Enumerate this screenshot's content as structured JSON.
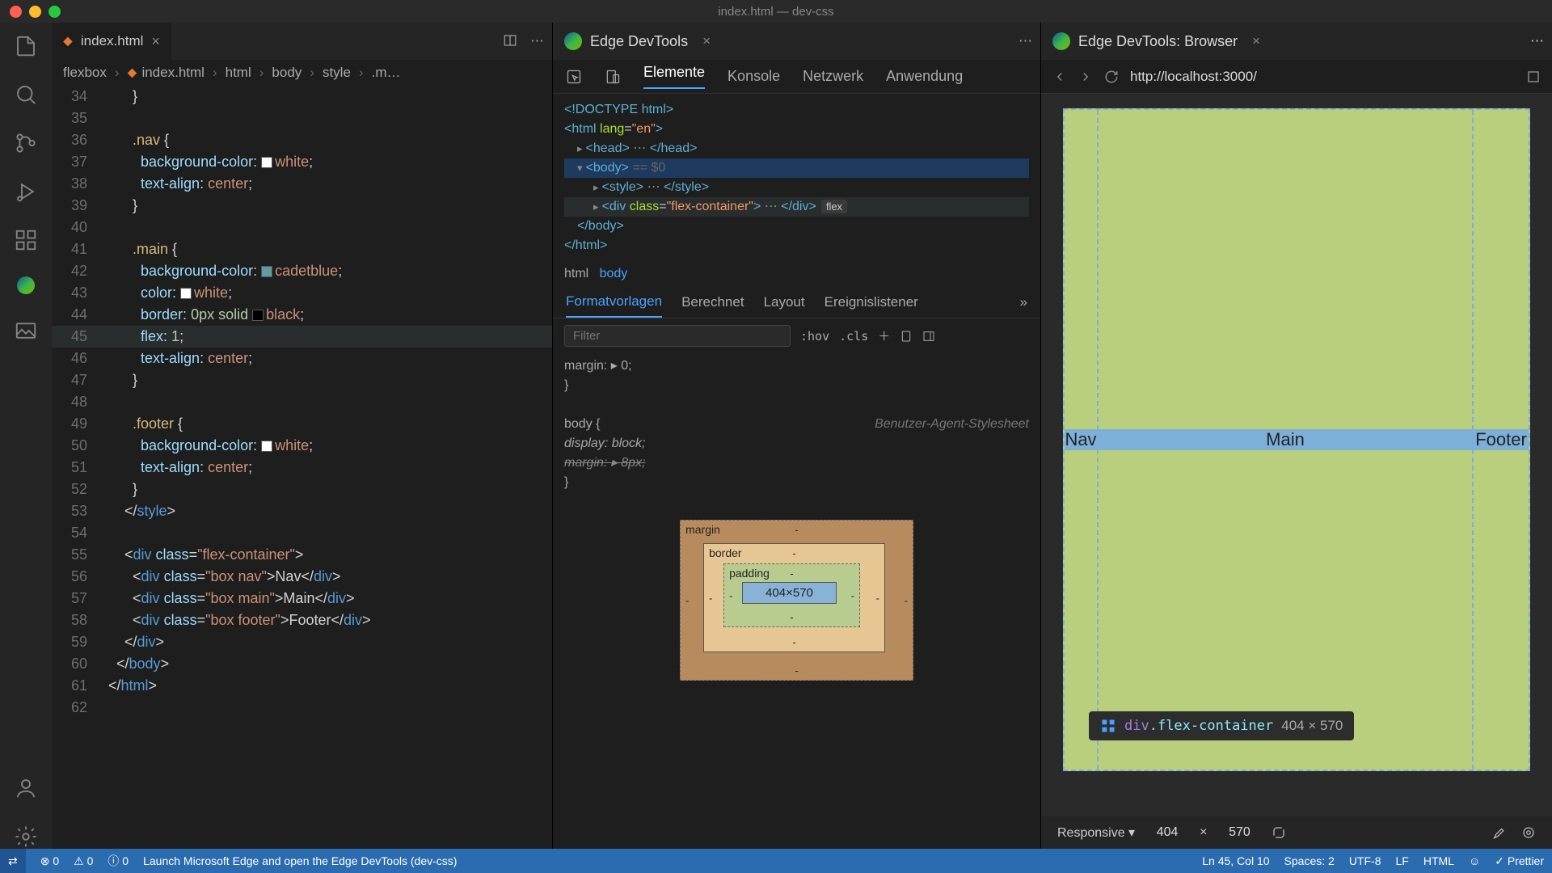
{
  "window": {
    "title": "index.html — dev-css"
  },
  "editor": {
    "tab_label": "index.html",
    "breadcrumb": [
      "flexbox",
      "index.html",
      "html",
      "body",
      "style",
      ".m…"
    ],
    "lines": [
      {
        "n": 34,
        "indent": 3,
        "t": "}"
      },
      {
        "n": 35,
        "indent": 0,
        "t": ""
      },
      {
        "n": 36,
        "indent": 3,
        "sel": ".nav",
        "t": " {"
      },
      {
        "n": 37,
        "indent": 4,
        "prop": "background-color",
        "swatch": "#ffffff",
        "val": "white"
      },
      {
        "n": 38,
        "indent": 4,
        "prop": "text-align",
        "val": "center"
      },
      {
        "n": 39,
        "indent": 3,
        "t": "}"
      },
      {
        "n": 40,
        "indent": 0,
        "t": ""
      },
      {
        "n": 41,
        "indent": 3,
        "sel": ".main",
        "t": " {"
      },
      {
        "n": 42,
        "indent": 4,
        "prop": "background-color",
        "swatch": "#5f9ea0",
        "val": "cadetblue"
      },
      {
        "n": 43,
        "indent": 4,
        "prop": "color",
        "swatch": "#ffffff",
        "val": "white"
      },
      {
        "n": 44,
        "indent": 4,
        "prop": "border",
        "val": "0px solid ",
        "swatch2": "#000000",
        "val2": "black"
      },
      {
        "n": 45,
        "indent": 4,
        "prop": "f|lex",
        "val": "1",
        "hl": true
      },
      {
        "n": 46,
        "indent": 4,
        "prop": "text-align",
        "val": "center"
      },
      {
        "n": 47,
        "indent": 3,
        "t": "}"
      },
      {
        "n": 48,
        "indent": 0,
        "t": ""
      },
      {
        "n": 49,
        "indent": 3,
        "sel": ".footer",
        "t": " {"
      },
      {
        "n": 50,
        "indent": 4,
        "prop": "background-color",
        "swatch": "#ffffff",
        "val": "white"
      },
      {
        "n": 51,
        "indent": 4,
        "prop": "text-align",
        "val": "center"
      },
      {
        "n": 52,
        "indent": 3,
        "t": "}"
      },
      {
        "n": 53,
        "indent": 2,
        "endtag": "style"
      },
      {
        "n": 54,
        "indent": 0,
        "t": ""
      },
      {
        "n": 55,
        "indent": 2,
        "otag": "div",
        "oattr": "class",
        "oattrv": "flex-container"
      },
      {
        "n": 56,
        "indent": 3,
        "otag": "div",
        "oattr": "class",
        "oattrv": "box nav",
        "inner": "Nav",
        "ctag": "div"
      },
      {
        "n": 57,
        "indent": 3,
        "otag": "div",
        "oattr": "class",
        "oattrv": "box main",
        "inner": "Main",
        "ctag": "div"
      },
      {
        "n": 58,
        "indent": 3,
        "otag": "div",
        "oattr": "class",
        "oattrv": "box footer",
        "inner": "Footer",
        "ctag": "div"
      },
      {
        "n": 59,
        "indent": 2,
        "endtag": "div"
      },
      {
        "n": 60,
        "indent": 1,
        "endtag": "body"
      },
      {
        "n": 61,
        "indent": 0,
        "endtag": "html"
      },
      {
        "n": 62,
        "indent": 0,
        "t": ""
      }
    ]
  },
  "devtools": {
    "tab_label": "Edge DevTools",
    "toolbar": [
      "Elemente",
      "Konsole",
      "Netzwerk",
      "Anwendung"
    ],
    "dom_lines": [
      "<!DOCTYPE html>",
      "<html lang=\"en\">",
      "  ▸ <head> … </head>",
      "  ▾ <body> == $0",
      "    ▸ <style> … </style>",
      "    ▸ <div class=\"flex-container\"> … </div> [flex]",
      "    </body>",
      "</html>"
    ],
    "bc_path": [
      "html",
      "body"
    ],
    "styles_tabs": [
      "Formatvorlagen",
      "Berechnet",
      "Layout",
      "Ereignislistener"
    ],
    "filter_placeholder": "Filter",
    "hov": ":hov",
    "cls": ".cls",
    "styles": {
      "rule1_line": "  margin: ▸ 0;",
      "rule1_close": "}",
      "rule2_sel": "body {",
      "rule2_agent": "Benutzer-Agent-Stylesheet",
      "rule2_p1": "  display: block;",
      "rule2_p2_strike": "  margin: ▸ 8px;",
      "rule2_close": "}"
    },
    "box_model": {
      "margin": "margin",
      "border": "border",
      "padding": "padding",
      "content": "404×570",
      "dash": "-"
    }
  },
  "browser": {
    "tab_label": "Edge DevTools: Browser",
    "url": "http://localhost:3000/",
    "preview": {
      "nav": "Nav",
      "main": "Main",
      "footer": "Footer"
    },
    "hover_tooltip": {
      "el": "div",
      "cls": ".flex-container",
      "dim": "404 × 570"
    },
    "device": {
      "mode": "Responsive",
      "w": "404",
      "h": "570"
    }
  },
  "status": {
    "errors": "0",
    "warnings": "0",
    "info": "0",
    "hint": "Launch Microsoft Edge and open the Edge DevTools (dev-css)",
    "cursor": "Ln 45, Col 10",
    "spaces": "Spaces: 2",
    "enc": "UTF-8",
    "eol": "LF",
    "lang": "HTML",
    "prettier": "Prettier"
  }
}
